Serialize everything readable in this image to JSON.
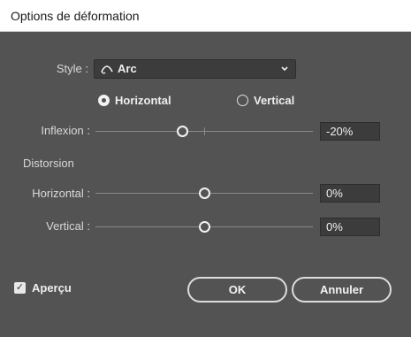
{
  "window": {
    "title": "Options de déformation"
  },
  "style": {
    "label": "Style :",
    "value": "Arc",
    "icon": "arc-icon"
  },
  "orientation": {
    "horizontal_label": "Horizontal",
    "vertical_label": "Vertical",
    "selected": "horizontal"
  },
  "inflexion": {
    "label": "Inflexion :",
    "value": "-20%",
    "percent": -20
  },
  "distortion": {
    "section_label": "Distorsion",
    "horizontal": {
      "label": "Horizontal :",
      "value": "0%",
      "percent": 0
    },
    "vertical": {
      "label": "Vertical :",
      "value": "0%",
      "percent": 0
    }
  },
  "preview": {
    "label": "Aperçu",
    "checked": true
  },
  "buttons": {
    "ok_label": "OK",
    "cancel_label": "Annuler"
  },
  "colors": {
    "panel": "#535353",
    "field": "#3c3c3c",
    "text": "#e6e6e6",
    "titlebar": "#ffffff"
  }
}
